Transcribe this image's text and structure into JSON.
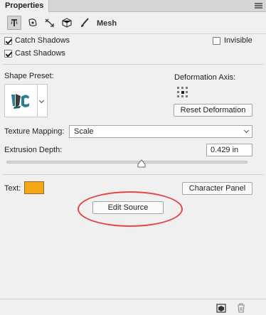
{
  "panel": {
    "tab_label": "Properties",
    "menu_icon": "panel-menu-icon"
  },
  "toolbar": {
    "tools": [
      {
        "icon": "mesh-tool-icon",
        "active": true
      },
      {
        "icon": "deformation-tool-icon",
        "active": false
      },
      {
        "icon": "cap-tool-icon",
        "active": false
      },
      {
        "icon": "coordinates-tool-icon",
        "active": false
      },
      {
        "icon": "material-brush-icon",
        "active": false
      }
    ],
    "mode_label": "Mesh"
  },
  "shadows": {
    "catch_label": "Catch Shadows",
    "catch_checked": true,
    "cast_label": "Cast Shadows",
    "cast_checked": true,
    "invisible_label": "Invisible",
    "invisible_checked": false
  },
  "shape": {
    "preset_label": "Shape Preset:",
    "preview_icon": "shape-preset-thumbnail",
    "deformation_axis_label": "Deformation Axis:",
    "reset_label": "Reset Deformation"
  },
  "texture": {
    "label": "Texture Mapping:",
    "value": "Scale"
  },
  "extrusion": {
    "label": "Extrusion Depth:",
    "value": "0.429 in",
    "slider_fraction": 0.56
  },
  "text_section": {
    "label": "Text:",
    "color": "#f5a614",
    "character_panel_label": "Character Panel",
    "edit_source_label": "Edit Source",
    "highlight_color": "#e64545"
  },
  "footer": {
    "icons": [
      "render-icon",
      "trash-icon"
    ]
  }
}
